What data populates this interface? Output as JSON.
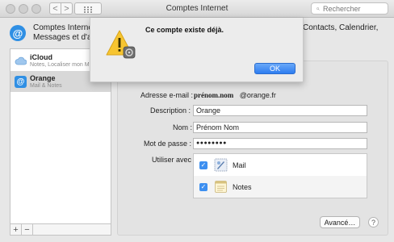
{
  "window": {
    "title": "Comptes Internet"
  },
  "toolbar": {
    "back": "<",
    "forward": ">",
    "search_placeholder": "Rechercher"
  },
  "header": {
    "line1": "Comptes Internet p",
    "line2": "Messages et d'auti",
    "line1_right": "Contacts, Calendrier,"
  },
  "sidebar": {
    "accounts": [
      {
        "name": "iCloud",
        "sub": "Notes, Localiser mon M"
      },
      {
        "name": "Orange",
        "sub": "Mail & Notes"
      }
    ],
    "add": "+",
    "remove": "−"
  },
  "form": {
    "email_label": "Adresse e-mail :",
    "email_value": "prénom.nom",
    "email_domain": "@orange.fr",
    "description_label": "Description :",
    "description_value": "Orange",
    "name_label": "Nom :",
    "name_value": "Prénom Nom",
    "password_label": "Mot de passe :",
    "password_value": "●●●●●●●●",
    "use_with_label": "Utiliser avec :",
    "apps": [
      {
        "label": "Mail",
        "checked": true
      },
      {
        "label": "Notes",
        "checked": true
      }
    ],
    "advanced_button": "Avancé…",
    "help": "?"
  },
  "alert": {
    "message": "Ce compte existe déjà.",
    "ok_button": "OK"
  }
}
